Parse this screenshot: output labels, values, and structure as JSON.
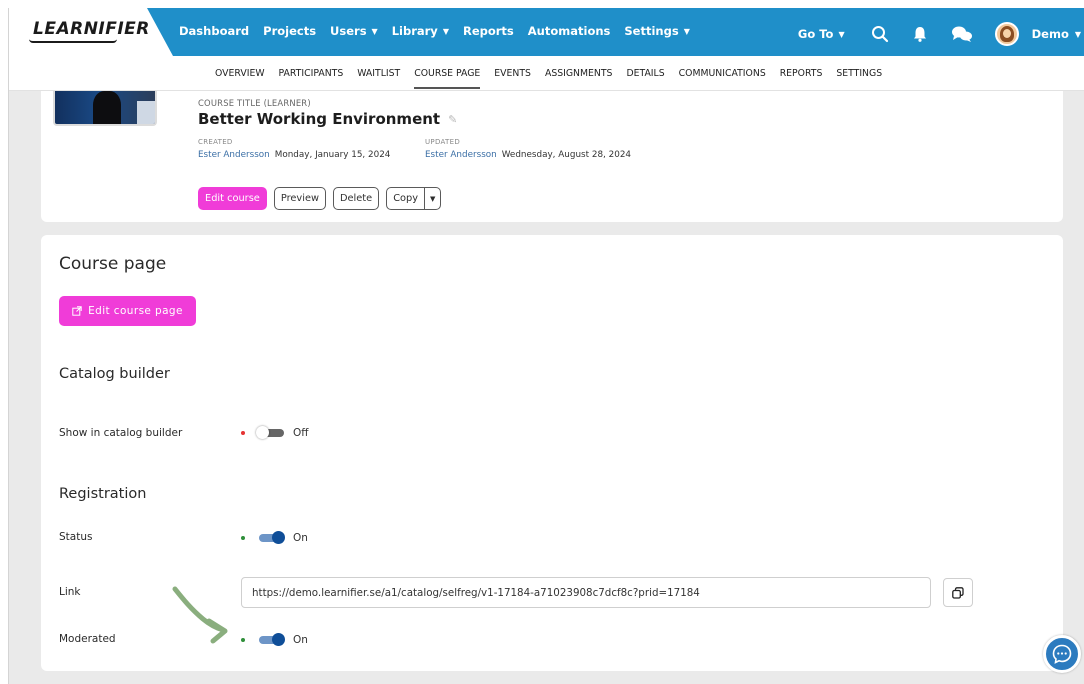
{
  "logo": {
    "text": "LEARNIFIER"
  },
  "nav": {
    "items": [
      {
        "label": "Dashboard"
      },
      {
        "label": "Projects"
      },
      {
        "label": "Users",
        "dropdown": true
      },
      {
        "label": "Library",
        "dropdown": true
      },
      {
        "label": "Reports"
      },
      {
        "label": "Automations"
      },
      {
        "label": "Settings",
        "dropdown": true
      }
    ],
    "goto": "Go To",
    "user": "Demo",
    "icons": [
      "search-icon",
      "bell-icon",
      "chat-bubbles-icon"
    ]
  },
  "tabs": [
    {
      "label": "OVERVIEW"
    },
    {
      "label": "PARTICIPANTS"
    },
    {
      "label": "WAITLIST"
    },
    {
      "label": "COURSE PAGE",
      "active": true
    },
    {
      "label": "EVENTS"
    },
    {
      "label": "ASSIGNMENTS"
    },
    {
      "label": "DETAILS"
    },
    {
      "label": "COMMUNICATIONS"
    },
    {
      "label": "REPORTS"
    },
    {
      "label": "SETTINGS"
    }
  ],
  "course": {
    "title_label": "COURSE TITLE (LEARNER)",
    "title": "Better Working Environment",
    "created_label": "CREATED",
    "created_by": "Ester Andersson",
    "created_date": "Monday, January 15, 2024",
    "updated_label": "UPDATED",
    "updated_by": "Ester Andersson",
    "updated_date": "Wednesday, August 28, 2024",
    "buttons": {
      "edit": "Edit course",
      "preview": "Preview",
      "delete": "Delete",
      "copy": "Copy"
    }
  },
  "course_page": {
    "heading": "Course page",
    "edit_button": "Edit course page",
    "catalog_heading": "Catalog builder",
    "show_in_catalog_label": "Show in catalog builder",
    "show_in_catalog_state": "Off",
    "registration_heading": "Registration",
    "status_label": "Status",
    "status_state": "On",
    "link_label": "Link",
    "link_value": "https://demo.learnifier.se/a1/catalog/selfreg/v1-17184-a71023908c7dcf8c?prid=17184",
    "moderated_label": "Moderated",
    "moderated_state": "On"
  },
  "colors": {
    "topbar": "#1f8fc9",
    "accent_pink": "#f03cd8",
    "toggle_on": "#0f4e98",
    "dot_off": "#e53333",
    "dot_on": "#2f8f3a",
    "arrow": "#8aae7e"
  }
}
